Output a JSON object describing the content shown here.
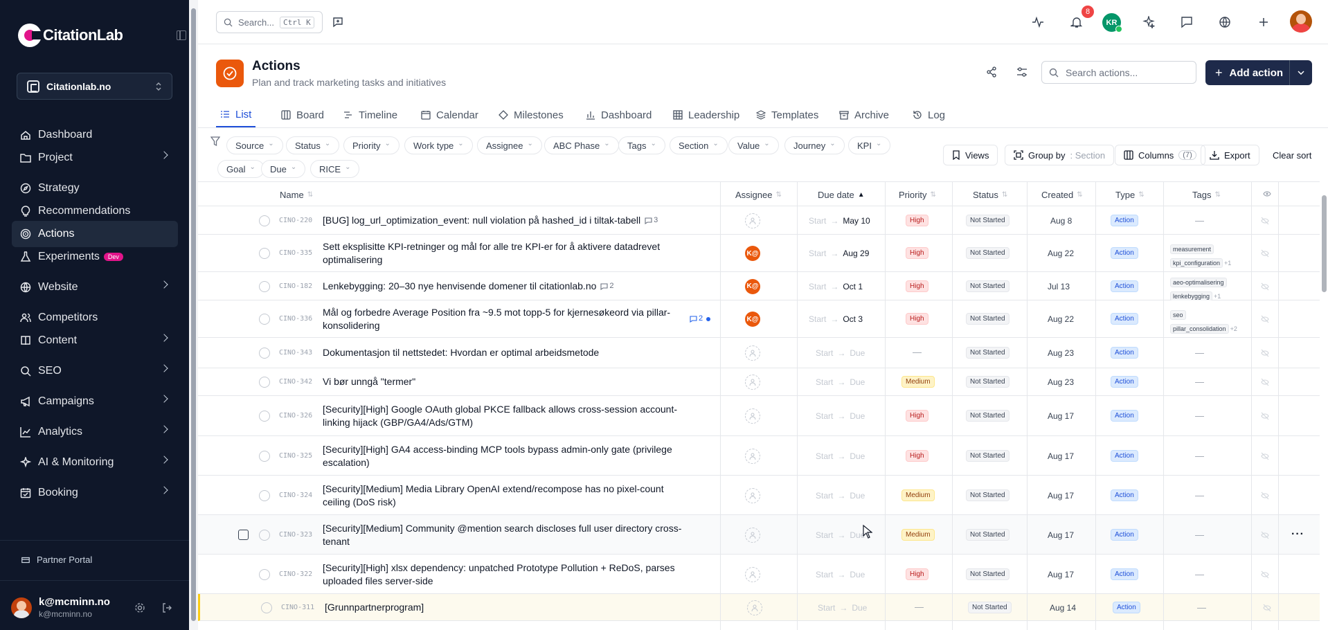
{
  "sidebar": {
    "logo": "CitationLab",
    "project": "Citationlab.no",
    "items": [
      {
        "label": "Dashboard",
        "icon": "home-icon",
        "chevron": false,
        "active": false
      },
      {
        "label": "Project",
        "icon": "folder-icon",
        "chevron": true,
        "active": false
      },
      {
        "label": "Strategy",
        "icon": "compass-icon",
        "chevron": false,
        "active": false
      },
      {
        "label": "Recommendations",
        "icon": "lightbulb-icon",
        "chevron": false,
        "active": false
      },
      {
        "label": "Actions",
        "icon": "target-icon",
        "chevron": false,
        "active": true
      },
      {
        "label": "Experiments",
        "icon": "flask-icon",
        "chevron": false,
        "active": false,
        "badge": "Dev"
      },
      {
        "label": "Website",
        "icon": "globe-icon",
        "chevron": true,
        "active": false
      },
      {
        "label": "Competitors",
        "icon": "users-icon",
        "chevron": false,
        "active": false
      },
      {
        "label": "Content",
        "icon": "book-icon",
        "chevron": true,
        "active": false
      },
      {
        "label": "SEO",
        "icon": "search-icon",
        "chevron": true,
        "active": false
      },
      {
        "label": "Campaigns",
        "icon": "megaphone-icon",
        "chevron": true,
        "active": false
      },
      {
        "label": "Analytics",
        "icon": "chart-icon",
        "chevron": true,
        "active": false
      },
      {
        "label": "AI & Monitoring",
        "icon": "bot-icon",
        "chevron": true,
        "active": false
      },
      {
        "label": "Booking",
        "icon": "calendar-icon",
        "chevron": true,
        "active": false
      }
    ],
    "partner_portal": "Partner Portal",
    "user": {
      "name": "k@mcminn.no",
      "email": "k@mcminn.no"
    }
  },
  "topbar": {
    "search_placeholder": "Search...",
    "shortcut": "Ctrl K",
    "notification_count": "8",
    "initials": "KR"
  },
  "page": {
    "title": "Actions",
    "subtitle": "Plan and track marketing tasks and initiatives",
    "search_placeholder": "Search actions...",
    "add_label": "Add action",
    "accent": "#ea580c"
  },
  "tabs": [
    "List",
    "Board",
    "Timeline",
    "Calendar",
    "Milestones",
    "Dashboard",
    "Leadership",
    "Templates",
    "Archive",
    "Log"
  ],
  "filters": [
    "Source",
    "Status",
    "Priority",
    "Work type",
    "Assignee",
    "ABC Phase",
    "Tags",
    "Section",
    "Value",
    "Journey",
    "KPI",
    "Goal",
    "Due",
    "RICE"
  ],
  "toolbar": {
    "views": "Views",
    "group_by": "Group by",
    "group_value": ": Section",
    "columns": "Columns",
    "columns_count": "(7)",
    "export": "Export",
    "clear_sort": "Clear sort"
  },
  "columns": {
    "name": "Name",
    "assignee": "Assignee",
    "due": "Due date",
    "priority": "Priority",
    "status": "Status",
    "created": "Created",
    "type": "Type",
    "tags": "Tags"
  },
  "due_start": "Start",
  "due_arrow": "→",
  "rows": [
    {
      "id": "CINO-220",
      "name": "[BUG] log_url_optimization_event: null violation på hashed_id i tiltak-tabell",
      "comments": "3",
      "comment_unread": false,
      "assignee": "",
      "due": "May 10",
      "priority": "High",
      "status": "Not Started",
      "created": "Aug 8",
      "type": "Action",
      "tags": [],
      "tags_more": ""
    },
    {
      "id": "CINO-335",
      "name": "Sett eksplisitte KPI-retninger og mål for alle tre KPI-er for å aktivere datadrevet optimalisering",
      "comments": "",
      "comment_unread": false,
      "assignee": "K@",
      "due": "Aug 29",
      "priority": "High",
      "status": "Not Started",
      "created": "Aug 22",
      "type": "Action",
      "tags": [
        "measurement",
        "kpi_configuration"
      ],
      "tags_more": "+1"
    },
    {
      "id": "CINO-182",
      "name": "Lenkebygging: 20–30 nye henvisende domener til citationlab.no",
      "comments": "2",
      "comment_unread": false,
      "assignee": "K@",
      "due": "Oct 1",
      "priority": "High",
      "status": "Not Started",
      "created": "Jul 13",
      "type": "Action",
      "tags": [
        "aeo-optimalisering",
        "lenkebygging"
      ],
      "tags_more": "+1"
    },
    {
      "id": "CINO-336",
      "name": "Mål og forbedre Average Position fra ~9.5 mot topp-5 for kjernesøkeord via pillar-konsolidering",
      "comments": "2",
      "comment_unread": true,
      "assignee": "K@",
      "due": "Oct 3",
      "priority": "High",
      "status": "Not Started",
      "created": "Aug 22",
      "type": "Action",
      "tags": [
        "seo",
        "pillar_consolidation"
      ],
      "tags_more": "+2"
    },
    {
      "id": "CINO-343",
      "name": "Dokumentasjon til nettstedet: Hvordan er optimal arbeidsmetode",
      "comments": "",
      "comment_unread": false,
      "assignee": "",
      "due": "Due",
      "priority": "—",
      "status": "Not Started",
      "created": "Aug 23",
      "type": "Action",
      "tags": [],
      "tags_more": ""
    },
    {
      "id": "CINO-342",
      "name": "Vi bør unngå \"termer\"",
      "comments": "",
      "comment_unread": false,
      "assignee": "",
      "due": "Due",
      "priority": "Medium",
      "status": "Not Started",
      "created": "Aug 23",
      "type": "Action",
      "tags": [],
      "tags_more": ""
    },
    {
      "id": "CINO-326",
      "name": "[Security][High] Google OAuth global PKCE fallback allows cross-session account-linking hijack (GBP/GA4/Ads/GTM)",
      "comments": "",
      "comment_unread": false,
      "assignee": "",
      "due": "Due",
      "priority": "High",
      "status": "Not Started",
      "created": "Aug 17",
      "type": "Action",
      "tags": [],
      "tags_more": ""
    },
    {
      "id": "CINO-325",
      "name": "[Security][High] GA4 access-binding MCP tools bypass admin-only gate (privilege escalation)",
      "comments": "",
      "comment_unread": false,
      "assignee": "",
      "due": "Due",
      "priority": "High",
      "status": "Not Started",
      "created": "Aug 17",
      "type": "Action",
      "tags": [],
      "tags_more": ""
    },
    {
      "id": "CINO-324",
      "name": "[Security][Medium] Media Library OpenAI extend/recompose has no pixel-count ceiling (DoS risk)",
      "comments": "",
      "comment_unread": false,
      "assignee": "",
      "due": "Due",
      "priority": "Medium",
      "status": "Not Started",
      "created": "Aug 17",
      "type": "Action",
      "tags": [],
      "tags_more": ""
    },
    {
      "id": "CINO-323",
      "name": "[Security][Medium] Community @mention search discloses full user directory cross-tenant",
      "comments": "",
      "comment_unread": false,
      "assignee": "",
      "due": "Due",
      "priority": "Medium",
      "status": "Not Started",
      "created": "Aug 17",
      "type": "Action",
      "tags": [],
      "tags_more": ""
    },
    {
      "id": "CINO-322",
      "name": "[Security][High] xlsx dependency: unpatched Prototype Pollution + ReDoS, parses uploaded files server-side",
      "comments": "",
      "comment_unread": false,
      "assignee": "",
      "due": "Due",
      "priority": "High",
      "status": "Not Started",
      "created": "Aug 17",
      "type": "Action",
      "tags": [],
      "tags_more": ""
    },
    {
      "id": "CINO-311",
      "name": "[Grunnpartnerprogram]",
      "comments": "",
      "comment_unread": false,
      "assignee": "",
      "due": "Due",
      "priority": "—",
      "status": "Not Started",
      "created": "Aug 14",
      "type": "Action",
      "tags": [],
      "tags_more": ""
    }
  ]
}
